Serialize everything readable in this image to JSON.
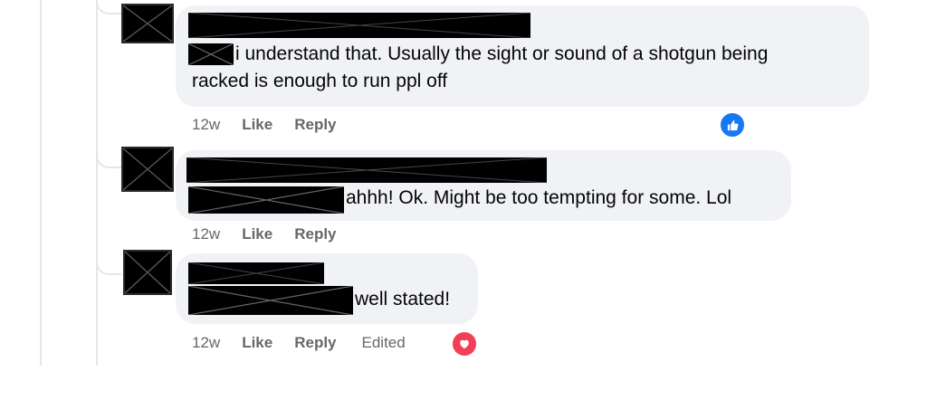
{
  "comments": [
    {
      "message": "i understand that. Usually the sight or sound of a shotgun being",
      "message_line2": "racked is enough to run ppl off",
      "time": "12w",
      "like_label": "Like",
      "reply_label": "Reply",
      "reaction": "like-reaction-icon"
    },
    {
      "message": "ahhh! Ok. Might be too tempting for some. Lol",
      "time": "12w",
      "like_label": "Like",
      "reply_label": "Reply"
    },
    {
      "message": "well stated!",
      "time": "12w",
      "like_label": "Like",
      "reply_label": "Reply",
      "edited_label": "Edited",
      "reaction": "love-reaction-icon"
    }
  ],
  "colors": {
    "bubble": "#f0f2f5",
    "meta_text": "#65676b",
    "like_blue": "#1877f2",
    "love_red": "#f33e58"
  }
}
